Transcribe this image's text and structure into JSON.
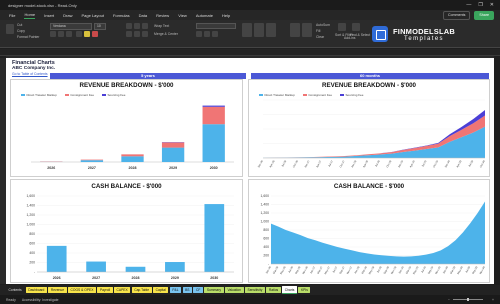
{
  "window": {
    "title": "designer model-stock.xlsx - Read-Only",
    "controls": [
      "—",
      "❐",
      "✕"
    ]
  },
  "menu": {
    "items": [
      "File",
      "Home",
      "Insert",
      "Draw",
      "Page Layout",
      "Formulas",
      "Data",
      "Review",
      "View",
      "Automate",
      "Help"
    ],
    "active_index": 1,
    "comments_label": "Comments",
    "share_label": "Share"
  },
  "ribbon": {
    "font_name": "Verdana",
    "font_size": "10",
    "wrap_text": "Wrap Text",
    "merge_center": "Merge & Center",
    "cut": "Cut",
    "copy": "Copy",
    "format_painter": "Format Painter",
    "autosum": "AutoSum",
    "fill": "Fill",
    "clear": "Clear",
    "sort_filter": "Sort & Filter",
    "find_select": "Find & Select",
    "add_ins": "Add-ins",
    "analyze_data": "Analyze Data"
  },
  "brand": {
    "name": "FINMODELSLAB",
    "sub": "Templates"
  },
  "sheet": {
    "title": "Financial Charts",
    "company": "ABC Company Inc.",
    "link": "Go to Table of Contents",
    "band_left": "5 years",
    "band_right": "60 months"
  },
  "legend": {
    "direct": "Direct Traveler Markup",
    "consignment": "Consignment Fee",
    "sourcing": "Sourcing Fee"
  },
  "colors": {
    "direct": "#4db3ea",
    "consignment": "#f07575",
    "sourcing": "#4b3fd6",
    "band": "#4b58d6",
    "cash": "#4db3ea",
    "accent": "#3aa55d"
  },
  "chart_data": [
    {
      "type": "bar",
      "title": "REVENUE BREAKDOWN - $'000",
      "categories": [
        "2026",
        "2027",
        "2028",
        "2029",
        "2030"
      ],
      "series": [
        {
          "name": "Direct Traveler Markup",
          "values": [
            10,
            60,
            190,
            480,
            1260
          ]
        },
        {
          "name": "Consignment Fee",
          "values": [
            5,
            20,
            65,
            170,
            580
          ]
        },
        {
          "name": "Sourcing Fee",
          "values": [
            0,
            0,
            0,
            10,
            40
          ]
        }
      ],
      "ylim": [
        0,
        2000
      ]
    },
    {
      "type": "area",
      "title": "REVENUE BREAKDOWN - $'000",
      "x": [
        "Jan-26",
        "Apr-26",
        "Jul-26",
        "Oct-26",
        "Jan-27",
        "Apr-27",
        "Jul-27",
        "Oct-27",
        "Jan-28",
        "Apr-28",
        "Jul-28",
        "Oct-28",
        "Jan-29",
        "Apr-29",
        "Jul-29",
        "Oct-29",
        "Jan-30",
        "Apr-30",
        "Jul-30",
        "Oct-30"
      ],
      "series": [
        {
          "name": "Direct Traveler Markup",
          "values": [
            0.5,
            1,
            1.5,
            2,
            3,
            4,
            5,
            6,
            9,
            12,
            15,
            19,
            26,
            32,
            39,
            46,
            70,
            90,
            110,
            135
          ]
        },
        {
          "name": "Consignment Fee",
          "values": [
            0.2,
            0.4,
            0.6,
            0.8,
            1,
            1.5,
            2,
            2.5,
            3,
            4,
            5,
            6.5,
            9,
            11,
            13,
            16,
            25,
            32,
            40,
            48
          ]
        },
        {
          "name": "Sourcing Fee",
          "values": [
            0,
            0,
            0,
            0,
            0,
            0,
            0,
            0,
            0,
            0,
            0.2,
            0.5,
            1,
            1.5,
            2,
            3,
            8,
            12,
            18,
            24
          ]
        }
      ],
      "ylim": [
        0,
        250
      ]
    },
    {
      "type": "bar",
      "title": "CASH BALANCE - $'000",
      "categories": [
        "2026",
        "2027",
        "2028",
        "2029",
        "2030"
      ],
      "series": [
        {
          "name": "Cash Balance",
          "values": [
            550,
            220,
            110,
            210,
            1430
          ]
        }
      ],
      "yticks": [
        "-",
        "200",
        "400",
        "600",
        "800",
        "1,000",
        "1,200",
        "1,400",
        "1,600"
      ],
      "ylim": [
        0,
        1600
      ]
    },
    {
      "type": "area",
      "title": "CASH BALANCE - $'000",
      "x": [
        "Jan-26",
        "Mar-26",
        "May-26",
        "Jul-26",
        "Sep-26",
        "Nov-26",
        "Jan-27",
        "Mar-27",
        "May-27",
        "Jul-27",
        "Sep-27",
        "Nov-27",
        "Jan-28",
        "Mar-28",
        "May-28",
        "Jul-28",
        "Sep-28",
        "Nov-28",
        "Jan-29",
        "Mar-29",
        "May-29",
        "Jul-29",
        "Sep-29",
        "Nov-29",
        "Jan-30",
        "Mar-30",
        "May-30",
        "Jul-30",
        "Sep-30",
        "Nov-30"
      ],
      "series": [
        {
          "name": "Cash Balance",
          "values": [
            950,
            880,
            800,
            740,
            680,
            610,
            560,
            500,
            450,
            400,
            360,
            320,
            280,
            250,
            225,
            205,
            190,
            180,
            175,
            180,
            195,
            220,
            260,
            320,
            420,
            560,
            740,
            960,
            1200,
            1470
          ]
        }
      ],
      "yticks": [
        "-",
        "200",
        "400",
        "600",
        "800",
        "1,000",
        "1,200",
        "1,400",
        "1,600"
      ],
      "ylim": [
        0,
        1600
      ]
    }
  ],
  "tabs": [
    {
      "label": "Contents",
      "style": "navy"
    },
    {
      "label": "Dashboard",
      "style": "yellow"
    },
    {
      "label": "Revenue",
      "style": "yellow"
    },
    {
      "label": "COGS & OPEX",
      "style": "yellow"
    },
    {
      "label": "Payroll",
      "style": "yellow"
    },
    {
      "label": "CAPEX",
      "style": "yellow"
    },
    {
      "label": "Cap.Table",
      "style": "yellow"
    },
    {
      "label": "Capital",
      "style": "yellow"
    },
    {
      "label": "P&L",
      "style": "blue"
    },
    {
      "label": "BS",
      "style": "blue"
    },
    {
      "label": "CF",
      "style": "blue"
    },
    {
      "label": "Summary",
      "style": "green"
    },
    {
      "label": "Valuation",
      "style": "green"
    },
    {
      "label": "Sensitivity",
      "style": "green"
    },
    {
      "label": "Ratios",
      "style": "green"
    },
    {
      "label": "Charts",
      "style": "active"
    },
    {
      "label": "KPIs",
      "style": "green"
    }
  ],
  "status": {
    "ready": "Ready",
    "accessibility": "Accessibility: Investigate"
  }
}
